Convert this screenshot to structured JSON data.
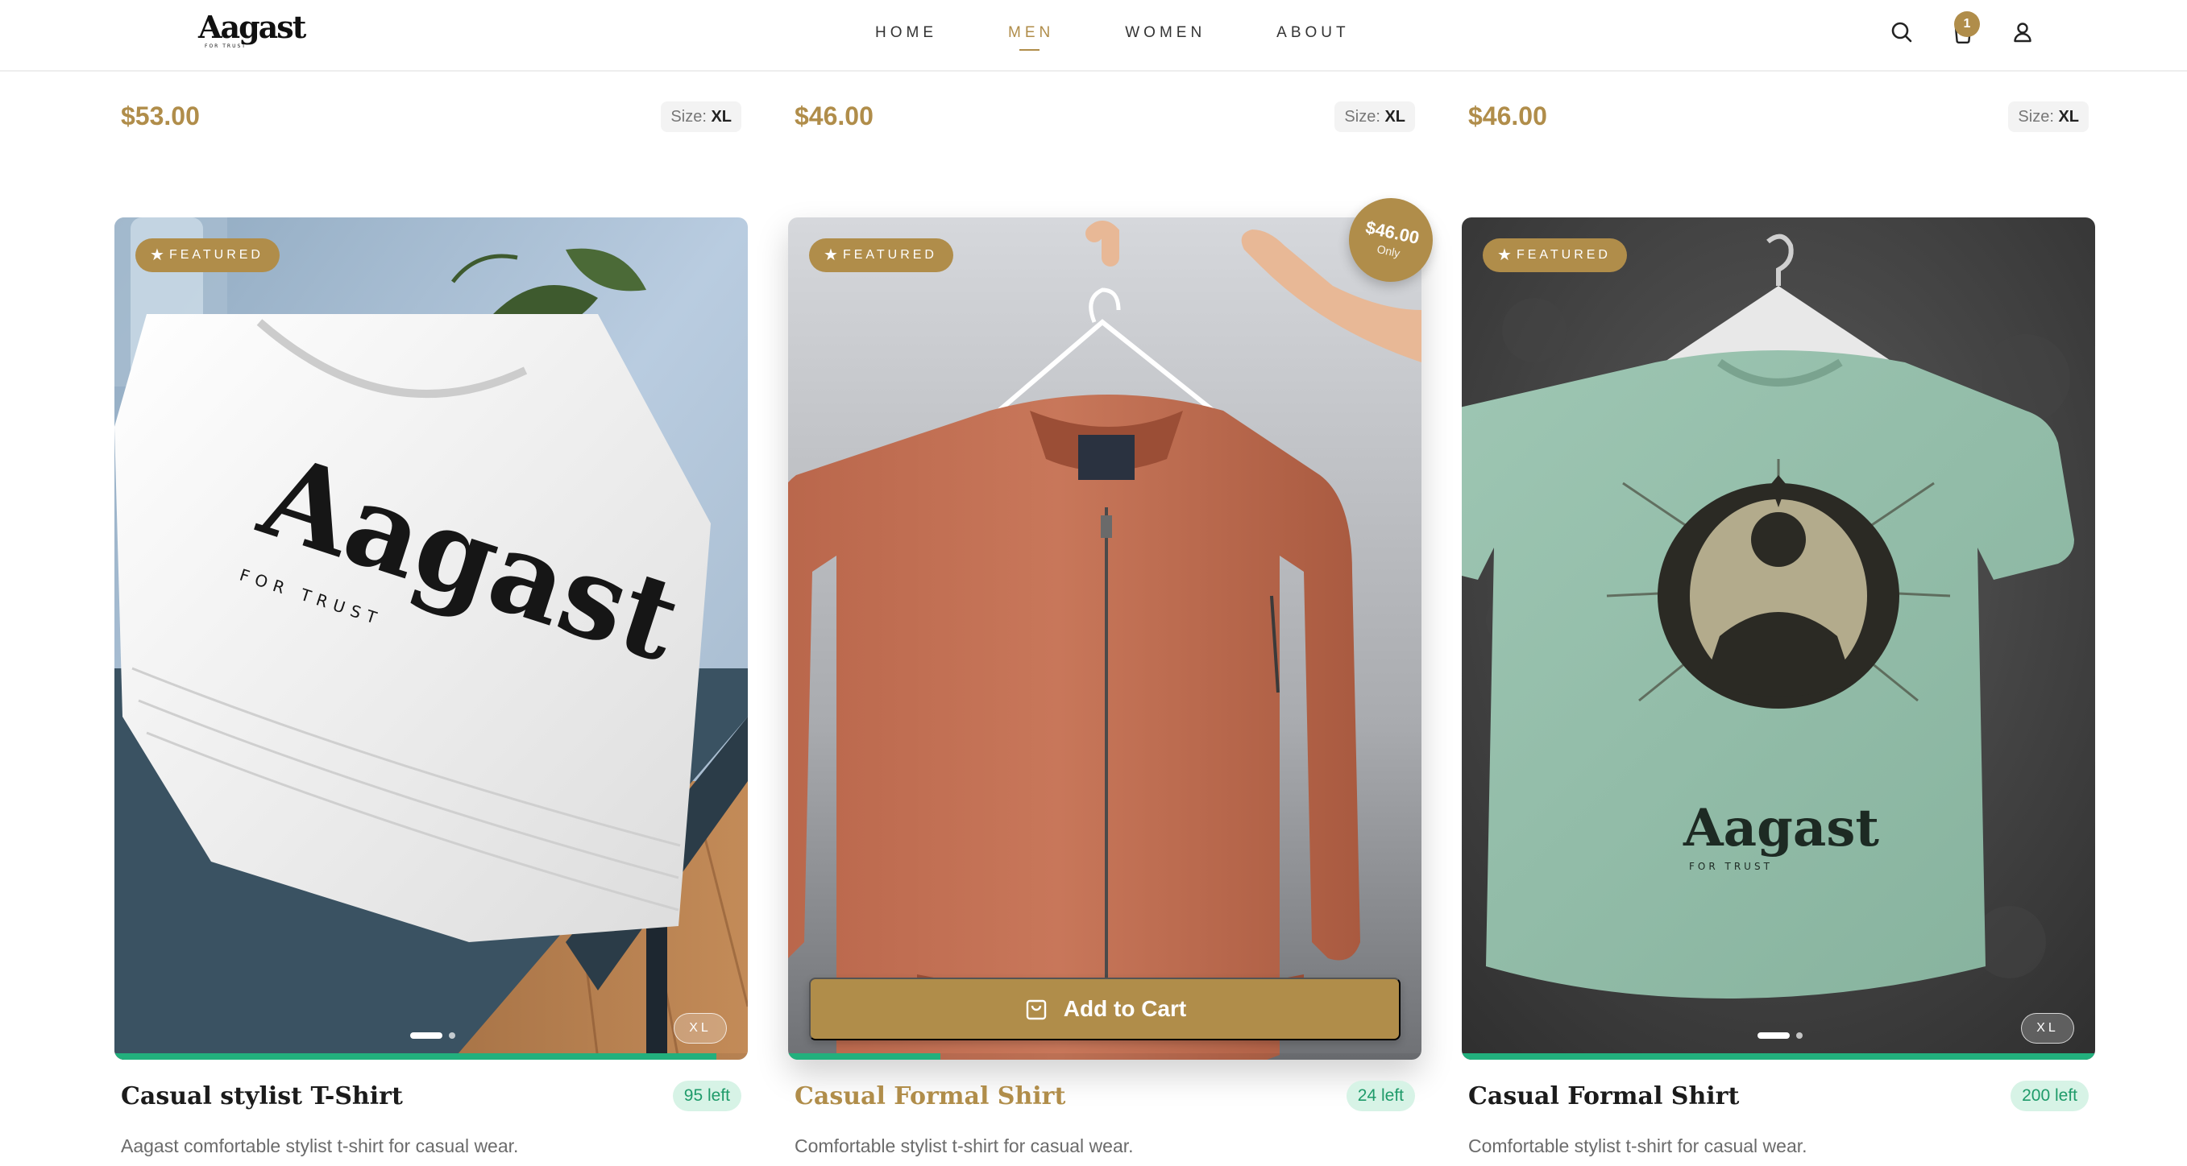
{
  "brand": {
    "logo_text": "Aagast",
    "logo_tagline": "FOR TRUST"
  },
  "nav": {
    "items": [
      {
        "label": "HOME",
        "active": false
      },
      {
        "label": "MEN",
        "active": true
      },
      {
        "label": "WOMEN",
        "active": false
      },
      {
        "label": "ABOUT",
        "active": false
      }
    ],
    "cart_count": "1",
    "icons": [
      "search-icon",
      "cart-icon",
      "user-icon"
    ]
  },
  "previous_row": [
    {
      "price": "$53.00",
      "size_label": "Size:",
      "size_value": "XL"
    },
    {
      "price": "$46.00",
      "size_label": "Size:",
      "size_value": "XL"
    },
    {
      "price": "$46.00",
      "size_label": "Size:",
      "size_value": "XL"
    }
  ],
  "products": [
    {
      "badge": "FEATURED",
      "size_tag": "XL",
      "title": "Casual stylist T-Shirt",
      "stock": "95 left",
      "stock_fraction": 0.95,
      "description": "Aagast comfortable stylist t-shirt for casual wear.",
      "shirt_print": "Aagast",
      "shirt_print_tagline": "FOR TRUST"
    },
    {
      "badge": "FEATURED",
      "price_badge": "$46.00",
      "price_badge_sub": "Only",
      "add_to_cart": "Add to Cart",
      "title": "Casual Formal Shirt",
      "stock": "24 left",
      "stock_fraction": 0.24,
      "description": "Comfortable stylist t-shirt for casual wear."
    },
    {
      "badge": "FEATURED",
      "size_tag": "XL",
      "title": "Casual Formal Shirt",
      "stock": "200 left",
      "stock_fraction": 1.0,
      "description": "Comfortable stylist t-shirt for casual wear.",
      "shirt_print": "Aagast",
      "shirt_print_tagline": "FOR TRUST"
    }
  ],
  "colors": {
    "accent": "#b08d4a",
    "stock_green": "#22b07d",
    "stock_pill_bg": "#d7f3e6",
    "stock_pill_text": "#1f9b6a"
  }
}
